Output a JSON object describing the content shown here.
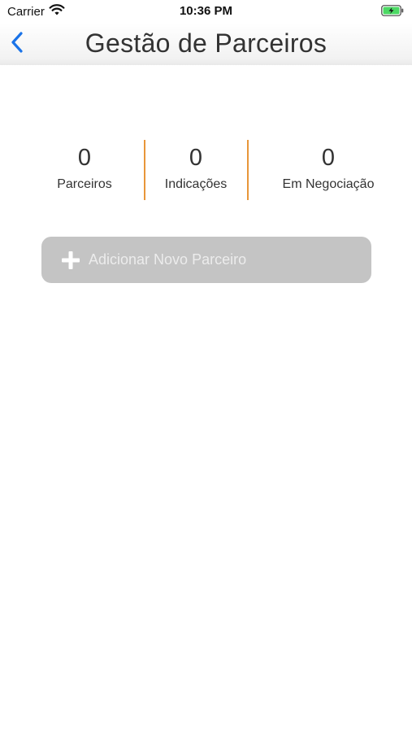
{
  "status_bar": {
    "carrier": "Carrier",
    "time": "10:36 PM",
    "wifi_icon": "wifi-icon",
    "battery_icon": "battery-charging-icon",
    "battery_color": "#4cd964"
  },
  "nav": {
    "back_icon": "chevron-left-icon",
    "title": "Gestão de Parceiros",
    "accent_color": "#1a73e8"
  },
  "stats": {
    "divider_color": "#e8963a",
    "items": [
      {
        "value": "0",
        "label": "Parceiros"
      },
      {
        "value": "0",
        "label": "Indicações"
      },
      {
        "value": "0",
        "label": "Em Negociação"
      }
    ]
  },
  "add_partner": {
    "icon": "plus-icon",
    "label": "Adicionar Novo Parceiro",
    "background": "#c4c4c4"
  }
}
